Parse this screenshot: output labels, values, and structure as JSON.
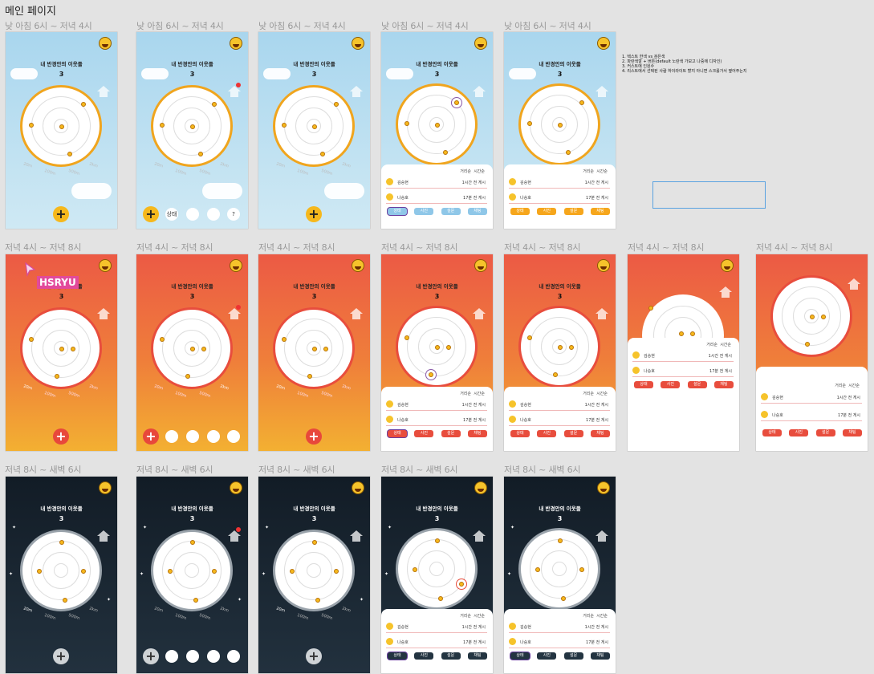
{
  "page_title": "메인 페이지",
  "labels": {
    "day": "낮 아침 6시 ~ 저녁 4시",
    "evening": "저녁 4시 ~ 저녁 8시",
    "night": "저녁 8시 ~ 새벽 6시"
  },
  "app": {
    "title": "내 반경안의 이웃들",
    "count": "3",
    "plus": "+",
    "distances": [
      "20m",
      "100m",
      "500m",
      "2km"
    ],
    "sort_distance": "거리순",
    "sort_time": "시간순",
    "rows": [
      {
        "name": "김승현",
        "time": "1시간 전 게시"
      },
      {
        "name": "나승호",
        "time": "17분 전 게시"
      }
    ],
    "buttons": [
      "상태",
      "사진",
      "설문",
      "채팅"
    ],
    "tool_icons": [
      "상태",
      "?"
    ]
  },
  "memo": [
    "1. 텍스트 한색 vs 검은색",
    "2. 파란색깔 + 버튼(default 노란색 가보고 나중에 디자인)",
    "3. 커스트에 인원수",
    "4. 리스트에서 선택된 사람 하이라이트 할지 아니면 스크롤가서 옆어주는지"
  ],
  "cursor_tag": "HSRYU"
}
